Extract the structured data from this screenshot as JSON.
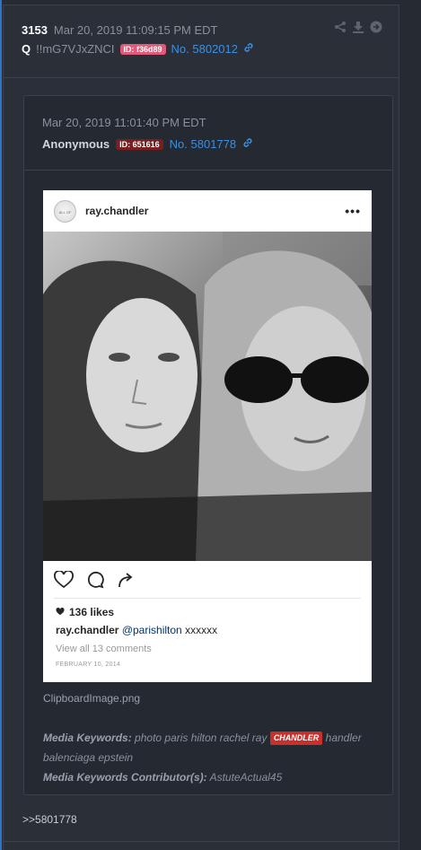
{
  "post": {
    "number": "3153",
    "date": "Mar 20, 2019 11:09:15 PM EDT",
    "name": "Q",
    "tripcode": "!!mG7VJxZNCI",
    "id_label": "ID: f36d89",
    "id_color": "#e05a7a",
    "post_link": "No. 5802012"
  },
  "quoted": {
    "date": "Mar 20, 2019 11:01:40 PM EDT",
    "name": "Anonymous",
    "id_label": "ID: 651616",
    "id_color": "#7a1f1f",
    "post_link": "No. 5801778"
  },
  "instagram": {
    "username": "ray.chandler",
    "avatar_text": "ALL OF",
    "likes": "136 likes",
    "caption_user": "ray.chandler",
    "caption_mention": "@parishilton",
    "caption_text": "xxxxxx",
    "view_all": "View all 13 comments",
    "date": "FEBRUARY 10, 2014"
  },
  "file_name": "ClipboardImage.png",
  "keywords": {
    "label": "Media Keywords:",
    "text_before": "photo paris hilton rachel ray",
    "highlight": "CHANDLER",
    "text_after": "handler balenciaga epstein",
    "contributor_label": "Media Keywords Contributor(s):",
    "contributor": "AstuteActual45"
  },
  "reply_text": ">>5801778"
}
